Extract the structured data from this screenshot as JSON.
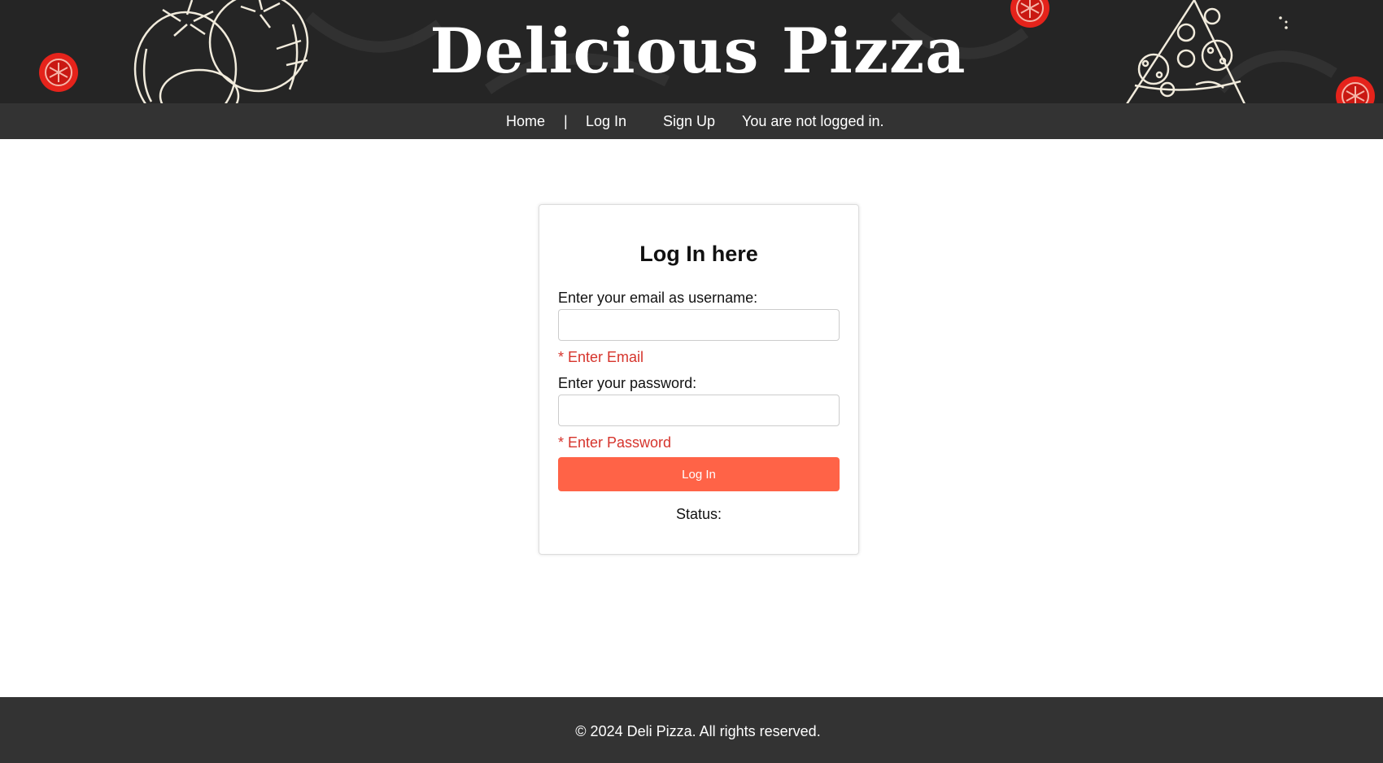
{
  "header": {
    "title": "Delicious Pizza"
  },
  "nav": {
    "home_label": "Home",
    "separator": "|",
    "login_label": "Log In",
    "signup_label": "Sign Up",
    "auth_status": "You are not logged in."
  },
  "login_form": {
    "title": "Log In here",
    "email_label": "Enter your email as username:",
    "email_value": "",
    "email_error": "* Enter Email",
    "password_label": "Enter your password:",
    "password_value": "",
    "password_error": "* Enter Password",
    "submit_label": "Log In",
    "status_label": "Status:"
  },
  "footer": {
    "copyright": "© 2024 Deli Pizza. All rights reserved."
  },
  "colors": {
    "banner_bg": "#252525",
    "nav_bg": "#333333",
    "accent": "#ff6347",
    "error": "#d6342c",
    "tomato": "#e5231b"
  },
  "icons": [
    "tomato-slice-icon",
    "tomatoes-sketch-icon",
    "pizza-slice-sketch-icon"
  ]
}
